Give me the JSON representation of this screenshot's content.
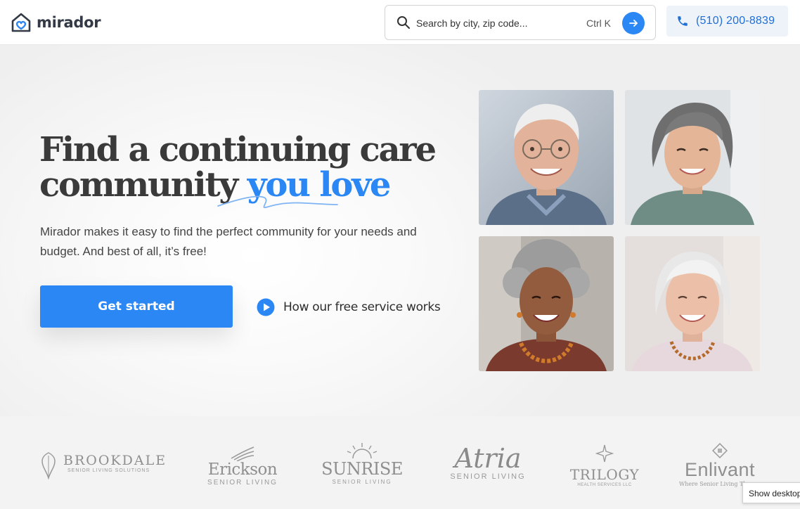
{
  "header": {
    "logo_text": "mirador",
    "search": {
      "placeholder": "Search by city, zip code...",
      "shortcut": "Ctrl K"
    },
    "phone": "(510) 200-8839"
  },
  "hero": {
    "title_line1": "Find a continuing care",
    "title_line2_plain": "community",
    "title_line2_accent": "you love",
    "subtitle": "Mirador makes it easy to find the perfect community for your needs and budget. And best of all, it’s free!",
    "primary_cta": "Get started",
    "secondary_cta": "How our free service works"
  },
  "logos": {
    "brookdale": {
      "main": "BROOKDALE",
      "sub": "SENIOR LIVING SOLUTIONS"
    },
    "erickson": {
      "main": "Erickson",
      "sub": "SENIOR LIVING"
    },
    "sunrise": {
      "main": "SUNRISE",
      "sub": "SENIOR LIVING"
    },
    "atria": {
      "main": "Atria",
      "sub": "SENIOR LIVING"
    },
    "trilogy": {
      "main": "TRILOGY",
      "sub": "HEALTH SERVICES LLC"
    },
    "enlivant": {
      "main": "Enlivant",
      "sub": "Where Senior Living Th"
    }
  },
  "tooltip": "Show desktop",
  "colors": {
    "accent": "#2b87f4",
    "phone_text": "#1f6fd6",
    "logo_gray": "#8f8f8f"
  },
  "icons": {
    "logo": "house-heart-icon",
    "search": "search-icon",
    "go": "arrow-right-icon",
    "phone": "phone-icon",
    "play": "play-icon"
  }
}
